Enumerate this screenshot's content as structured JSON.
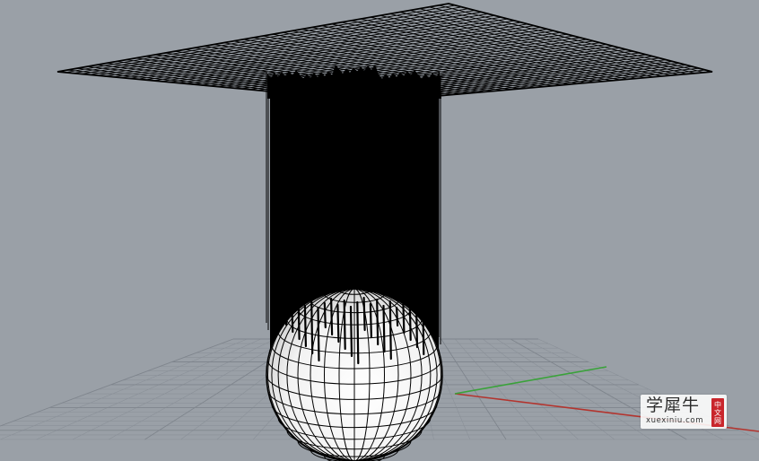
{
  "viewport": {
    "background_color": "#9aa0a7",
    "grid_minor_color": "#8a9098",
    "grid_major_color": "#7f858d",
    "wire_color": "#000000",
    "sphere_fill_color": "#f2f2f2",
    "axis_x_color": "#b3342e",
    "axis_y_color": "#3aa23a"
  },
  "objects": {
    "plane": "wireframe-surface",
    "curtain": "projected-curves",
    "sphere": "wireframe-sphere"
  },
  "watermark": {
    "title": "学犀牛",
    "subtitle": "xuexiniu.com",
    "tag": [
      "中",
      "文",
      "网"
    ],
    "tag_color": "#c9262c"
  }
}
